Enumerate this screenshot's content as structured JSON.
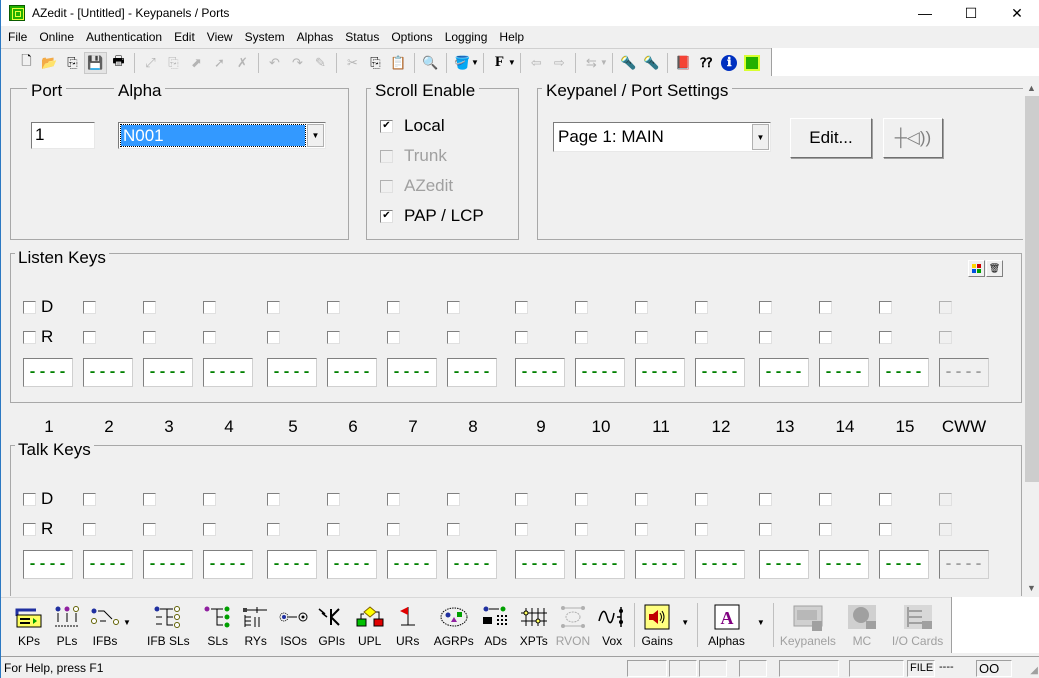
{
  "window": {
    "title": "AZedit - [Untitled] - Keypanels / Ports",
    "minimize_glyph": "—",
    "maximize_glyph": "☐",
    "close_glyph": "✕"
  },
  "menu": [
    "File",
    "Online",
    "Authentication",
    "Edit",
    "View",
    "System",
    "Alphas",
    "Status",
    "Options",
    "Logging",
    "Help"
  ],
  "toolbar": {
    "icons": [
      {
        "name": "new-icon",
        "glyph": "🗋"
      },
      {
        "name": "open-icon",
        "glyph": "📂"
      },
      {
        "name": "copy-doc-icon",
        "glyph": "⎘"
      },
      {
        "name": "save-icon",
        "glyph": "💾"
      },
      {
        "name": "print-icon",
        "glyph": "🖶"
      },
      {
        "name": "connect-icon",
        "glyph": "⤢"
      },
      {
        "name": "copy-online-icon",
        "glyph": "⎘"
      },
      {
        "name": "send-icon",
        "glyph": "⬈"
      },
      {
        "name": "arrow-up-right-icon",
        "glyph": "➚"
      },
      {
        "name": "disconnect-icon",
        "glyph": "✗"
      },
      {
        "name": "undo-icon",
        "glyph": "↶"
      },
      {
        "name": "redo-icon",
        "glyph": "↷"
      },
      {
        "name": "eraser-icon",
        "glyph": "✎"
      },
      {
        "name": "cut-icon",
        "glyph": "✂"
      },
      {
        "name": "copy-icon",
        "glyph": "⎘"
      },
      {
        "name": "paste-icon",
        "glyph": "📋"
      },
      {
        "name": "search-icon",
        "glyph": "🔍"
      },
      {
        "name": "paint-icon",
        "glyph": "🪣"
      },
      {
        "name": "font-icon",
        "glyph": "F"
      },
      {
        "name": "back-icon",
        "glyph": "⇦"
      },
      {
        "name": "forward-icon",
        "glyph": "⇨"
      },
      {
        "name": "network-icon",
        "glyph": "⇆"
      },
      {
        "name": "flashlight-icon",
        "glyph": "🔦"
      },
      {
        "name": "flashlight2-icon",
        "glyph": "🔦"
      },
      {
        "name": "book-icon",
        "glyph": "📕"
      },
      {
        "name": "context-help-icon",
        "glyph": "⁇"
      },
      {
        "name": "info-icon",
        "glyph": "ℹ"
      },
      {
        "name": "azedit-logo-icon",
        "glyph": "▦"
      }
    ]
  },
  "port_group": {
    "port_label": "Port",
    "alpha_label": "Alpha",
    "port_value": "1",
    "alpha_value": "N001"
  },
  "scroll_enable": {
    "title": "Scroll Enable",
    "options": [
      {
        "label": "Local",
        "checked": true,
        "enabled": true
      },
      {
        "label": "Trunk",
        "checked": false,
        "enabled": false
      },
      {
        "label": "AZedit",
        "checked": false,
        "enabled": false
      },
      {
        "label": "PAP / LCP",
        "checked": true,
        "enabled": true
      }
    ]
  },
  "keypanel_settings": {
    "title": "Keypanel / Port Settings",
    "page_value": "Page 1: MAIN",
    "edit_label": "Edit...",
    "audio_icon": "speaker-level-icon"
  },
  "listen_keys": {
    "title": "Listen Keys",
    "d_label": "D",
    "r_label": "R",
    "values": [
      "----",
      "----",
      "----",
      "----",
      "----",
      "----",
      "----",
      "----",
      "----",
      "----",
      "----",
      "----",
      "----",
      "----",
      "----",
      "----"
    ]
  },
  "key_numbers": [
    "1",
    "2",
    "3",
    "4",
    "5",
    "6",
    "7",
    "8",
    "9",
    "10",
    "11",
    "12",
    "13",
    "14",
    "15",
    "CWW"
  ],
  "talk_keys": {
    "title": "Talk Keys",
    "d_label": "D",
    "r_label": "R",
    "values": [
      "----",
      "----",
      "----",
      "----",
      "----",
      "----",
      "----",
      "----",
      "----",
      "----",
      "----",
      "----",
      "----",
      "----",
      "----",
      "----"
    ]
  },
  "bottom_toolbar": [
    {
      "label": "KPs",
      "enabled": true
    },
    {
      "label": "PLs",
      "enabled": true
    },
    {
      "label": "IFBs",
      "enabled": true,
      "dropdown": true
    },
    {
      "label": "IFB SLs",
      "enabled": true
    },
    {
      "label": "SLs",
      "enabled": true
    },
    {
      "label": "RYs",
      "enabled": true
    },
    {
      "label": "ISOs",
      "enabled": true
    },
    {
      "label": "GPIs",
      "enabled": true
    },
    {
      "label": "UPL",
      "enabled": true
    },
    {
      "label": "URs",
      "enabled": true
    },
    {
      "label": "AGRPs",
      "enabled": true
    },
    {
      "label": "ADs",
      "enabled": true
    },
    {
      "label": "XPTs",
      "enabled": true
    },
    {
      "label": "RVON",
      "enabled": false
    },
    {
      "label": "Vox",
      "enabled": true
    },
    {
      "label": "Gains",
      "enabled": true,
      "dropdown": true
    },
    {
      "label": "Alphas",
      "enabled": true,
      "dropdown": true
    },
    {
      "label": "Keypanels",
      "enabled": false
    },
    {
      "label": "MC",
      "enabled": false
    },
    {
      "label": "I/O Cards",
      "enabled": false
    }
  ],
  "status": {
    "help_text": "For Help, press F1",
    "file_label": "FILE",
    "file_value": "----",
    "indicator": "OO"
  }
}
